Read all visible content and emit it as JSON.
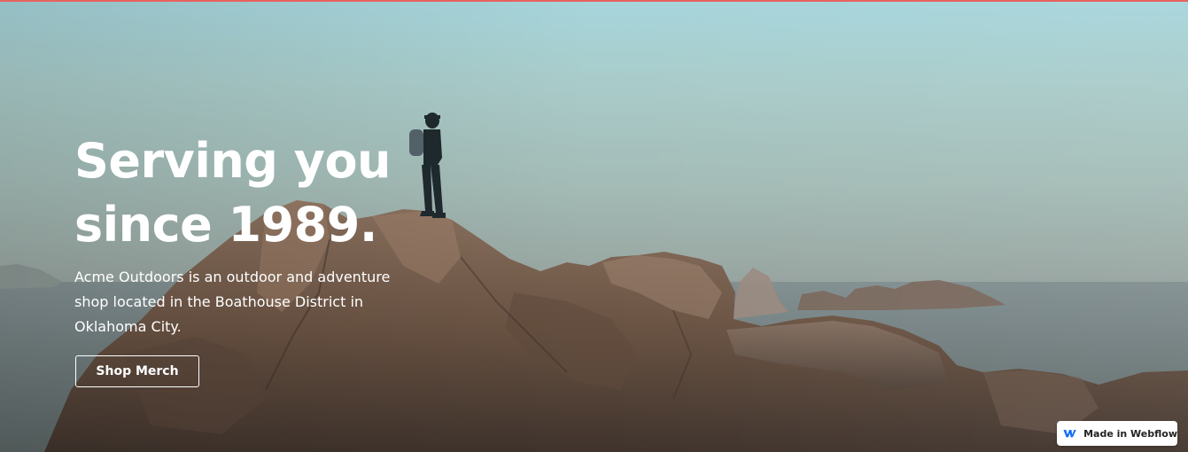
{
  "hero": {
    "headline_line1": "Serving you",
    "headline_line2": "since 1989.",
    "subtext": "Acme Outdoors is an outdoor and adventure shop located in the Boathouse District in Oklahoma City.",
    "cta_label": "Shop Merch",
    "image_description_icon": "hiker-on-rocky-cliff-photo"
  },
  "badge": {
    "label": "Made in Webflow",
    "icon": "webflow-logo-icon"
  },
  "colors": {
    "top_accent": "#e8625e",
    "text": "#ffffff",
    "webflow_blue": "#146ef5"
  }
}
